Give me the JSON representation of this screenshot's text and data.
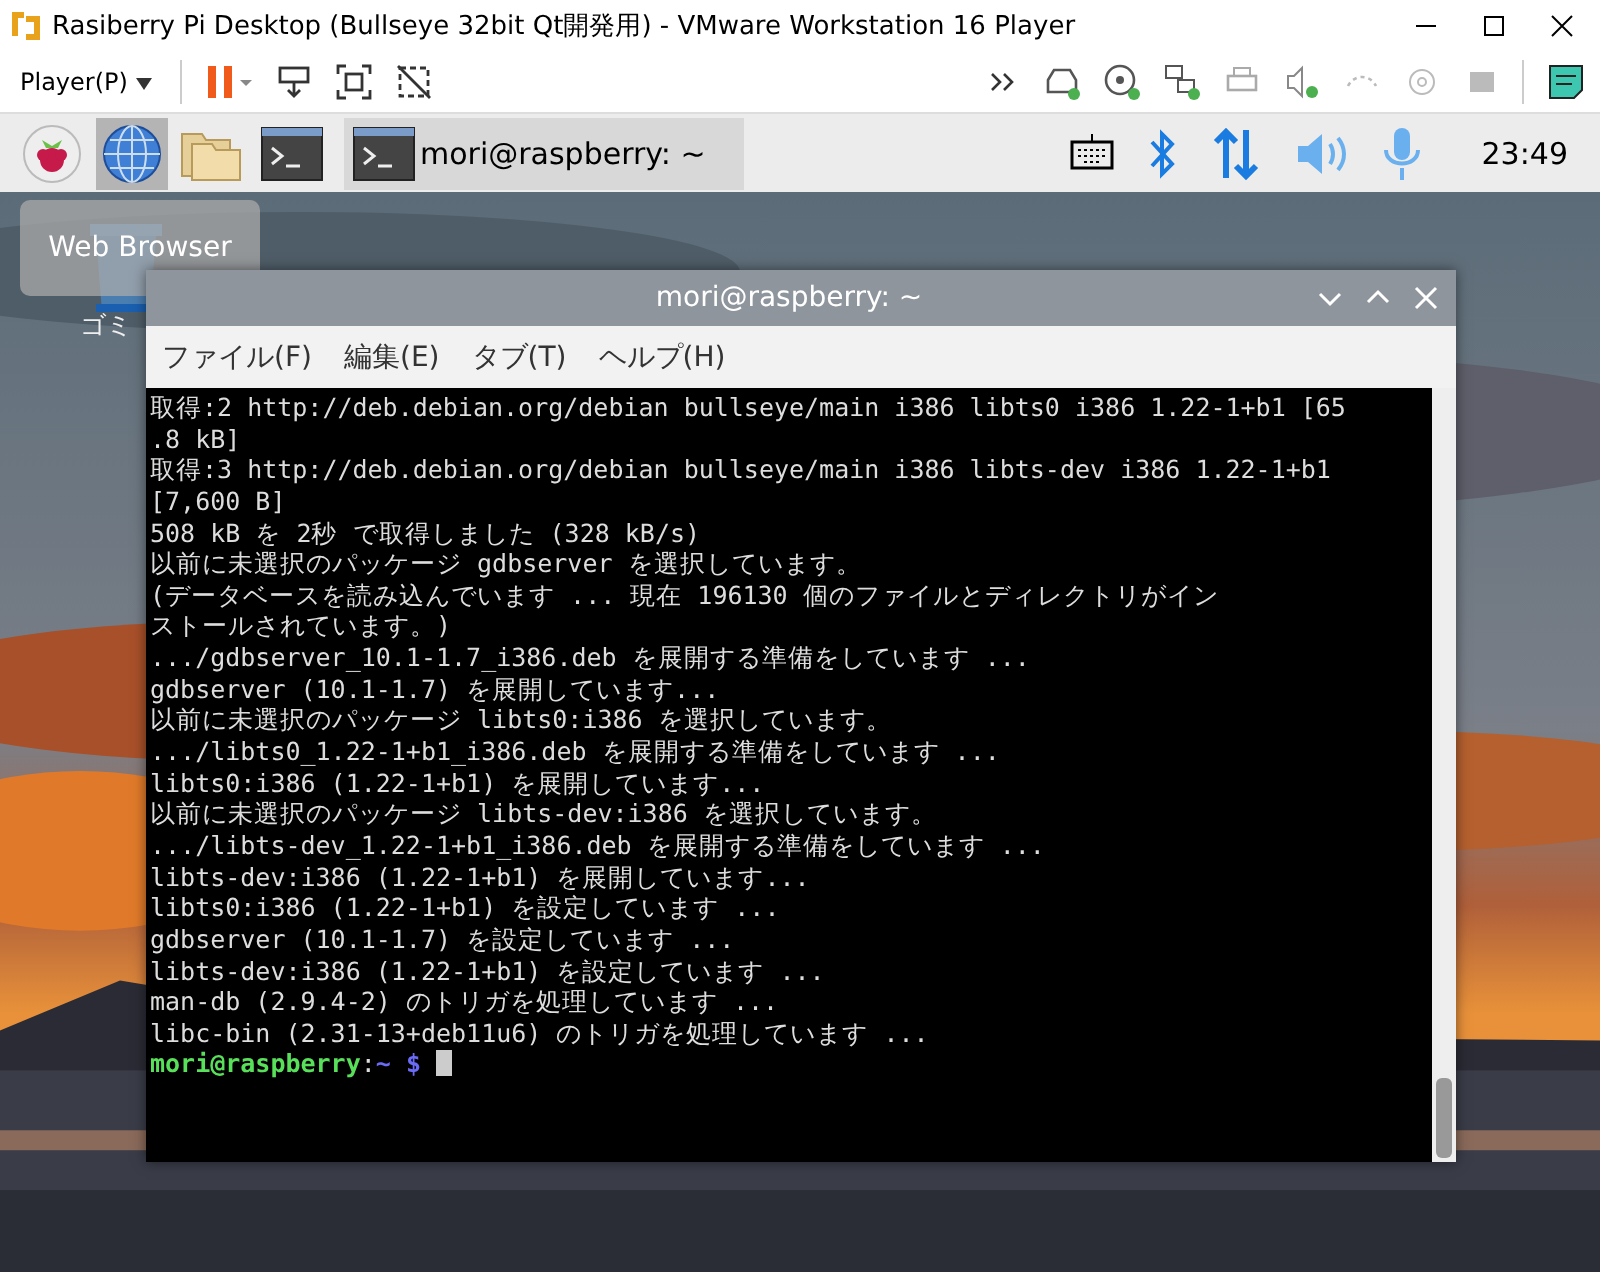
{
  "vm_window": {
    "title": "Rasiberry Pi Desktop (Bullseye 32bit Qt開発用) - VMware Workstation 16 Player"
  },
  "vm_toolbar": {
    "menu": "Player(P)"
  },
  "taskbar": {
    "launchers": [
      {
        "kind": "raspberry",
        "selected": false
      },
      {
        "kind": "globe",
        "selected": true
      },
      {
        "kind": "folder",
        "selected": false
      },
      {
        "kind": "terminal",
        "selected": false
      }
    ],
    "task": {
      "label": "mori@raspberry: ~"
    },
    "clock": "23:49"
  },
  "desktop": {
    "tooltip": "Web Browser",
    "icon_label": "ゴミ"
  },
  "terminal": {
    "title": "mori@raspberry: ~",
    "menus": [
      "ファイル(F)",
      "編集(E)",
      "タブ(T)",
      "ヘルプ(H)"
    ],
    "lines": [
      "取得:2 http://deb.debian.org/debian bullseye/main i386 libts0 i386 1.22-1+b1 [65",
      ".8 kB]",
      "取得:3 http://deb.debian.org/debian bullseye/main i386 libts-dev i386 1.22-1+b1",
      "[7,600 B]",
      "508 kB を 2秒 で取得しました (328 kB/s)",
      "以前に未選択のパッケージ gdbserver を選択しています。",
      "(データベースを読み込んでいます ... 現在 196130 個のファイルとディレクトリがイン",
      "ストールされています。)",
      ".../gdbserver_10.1-1.7_i386.deb を展開する準備をしています ...",
      "gdbserver (10.1-1.7) を展開しています...",
      "以前に未選択のパッケージ libts0:i386 を選択しています。",
      ".../libts0_1.22-1+b1_i386.deb を展開する準備をしています ...",
      "libts0:i386 (1.22-1+b1) を展開しています...",
      "以前に未選択のパッケージ libts-dev:i386 を選択しています。",
      ".../libts-dev_1.22-1+b1_i386.deb を展開する準備をしています ...",
      "libts-dev:i386 (1.22-1+b1) を展開しています...",
      "libts0:i386 (1.22-1+b1) を設定しています ...",
      "gdbserver (10.1-1.7) を設定しています ...",
      "libts-dev:i386 (1.22-1+b1) を設定しています ...",
      "man-db (2.9.4-2) のトリガを処理しています ...",
      "libc-bin (2.31-13+deb11u6) のトリガを処理しています ..."
    ],
    "prompt": {
      "user": "mori@raspberry",
      "separator": ":",
      "path": "~ $"
    }
  }
}
